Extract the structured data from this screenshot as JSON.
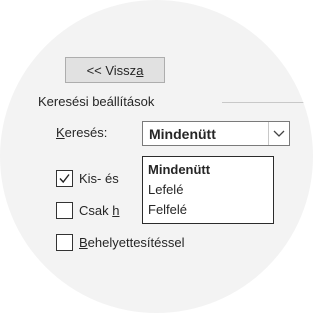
{
  "back_button": {
    "label_prefix": "<< Vissz",
    "label_underlined": "a"
  },
  "search_options": {
    "group_title": "Keresési beállítások",
    "search_label_underlined": "K",
    "search_label_rest": "eresés:",
    "direction_value": "Mindenütt",
    "direction_options": [
      "Mindenütt",
      "Lefelé",
      "Felfelé"
    ]
  },
  "checkboxes": [
    {
      "prefix": "Kis- és",
      "underlined": "",
      "suffix": "",
      "checked": true
    },
    {
      "prefix": "Csak ",
      "underlined": "h",
      "suffix": "",
      "checked": false
    },
    {
      "prefix": "",
      "underlined": "B",
      "suffix": "ehelyettesítéssel",
      "checked": false
    }
  ]
}
